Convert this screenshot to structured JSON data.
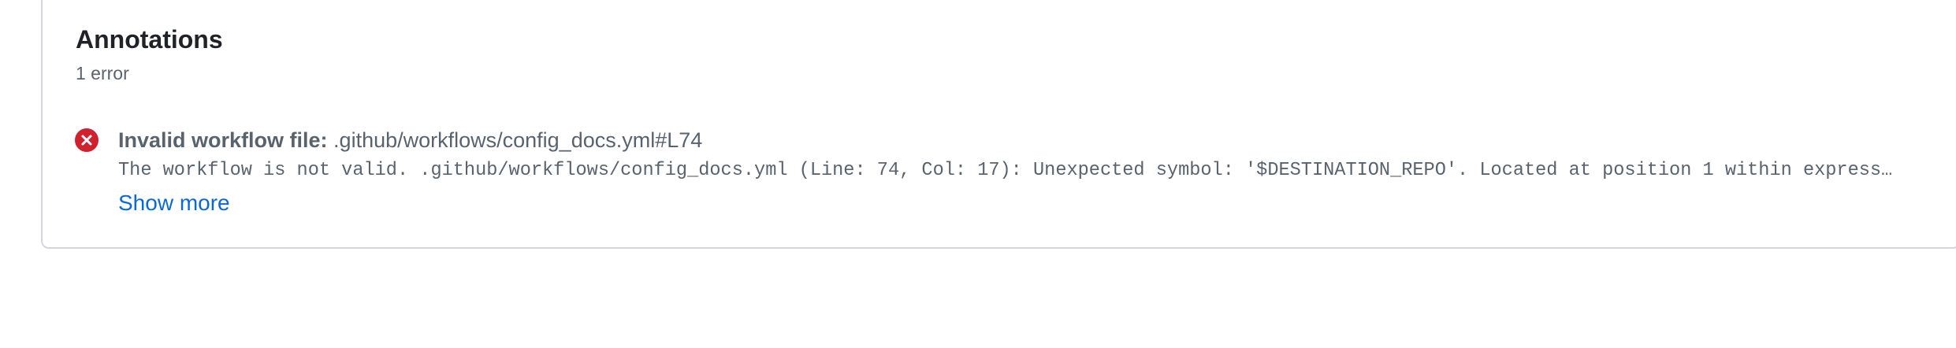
{
  "annotations": {
    "title": "Annotations",
    "count_label": "1 error",
    "items": [
      {
        "severity_icon": "x-circle-fill-icon",
        "severity_color": "#cf222e",
        "label": "Invalid workflow file:",
        "location": ".github/workflows/config_docs.yml#L74",
        "message": "The workflow is not valid. .github/workflows/config_docs.yml (Line: 74, Col: 17): Unexpected symbol: '$DESTINATION_REPO'. Located at position 1 within express…",
        "show_more_label": "Show more"
      }
    ]
  },
  "colors": {
    "border": "#d0d7de",
    "muted_text": "#59636e",
    "link": "#0969da",
    "error": "#cf222e"
  }
}
